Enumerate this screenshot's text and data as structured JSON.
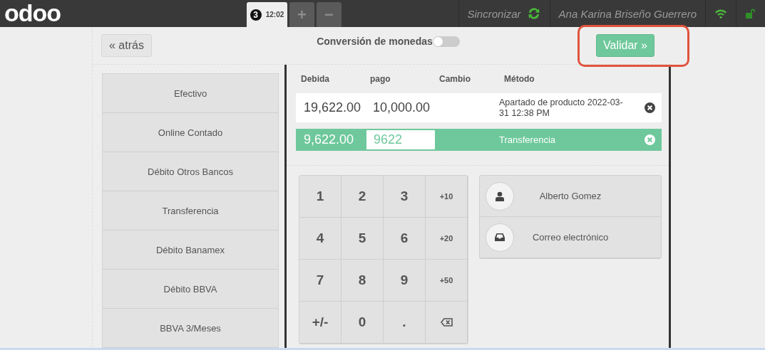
{
  "header": {
    "logo": "odoo",
    "orders": [
      {
        "number": "3",
        "time": "12:02",
        "selected": true
      }
    ],
    "add_order": "+",
    "remove_order": "−",
    "sync": "Sincronizar",
    "user": "Ana Karina Briseño Guerrero"
  },
  "toolbar": {
    "back": "« atrás",
    "title": "Conversión de monedas",
    "currency_conversion_on": false,
    "validate": "Validar »"
  },
  "payment_methods": [
    "Efectivo",
    "Online Contado",
    "Débito Otros Bancos",
    "Transferencia",
    "Débito Banamex",
    "Débito BBVA",
    "BBVA 3/Meses"
  ],
  "columns": [
    "Debida",
    "pago",
    "Cambio",
    "Método"
  ],
  "lines": [
    {
      "due": "19,622.00",
      "paid": "10,000.00",
      "method": "Apartado de producto 2022-03-31 12:38 PM",
      "selected": false
    },
    {
      "due": "9,622.00",
      "paid": "9622",
      "method": "Transferencia",
      "selected": true
    }
  ],
  "keypad": [
    {
      "kind": "digit",
      "label": "1"
    },
    {
      "kind": "digit",
      "label": "2"
    },
    {
      "kind": "digit",
      "label": "3"
    },
    {
      "kind": "add",
      "label": "+10"
    },
    {
      "kind": "digit",
      "label": "4"
    },
    {
      "kind": "digit",
      "label": "5"
    },
    {
      "kind": "digit",
      "label": "6"
    },
    {
      "kind": "add",
      "label": "+20"
    },
    {
      "kind": "digit",
      "label": "7"
    },
    {
      "kind": "digit",
      "label": "8"
    },
    {
      "kind": "digit",
      "label": "9"
    },
    {
      "kind": "add",
      "label": "+50"
    },
    {
      "kind": "digit",
      "label": "+/-"
    },
    {
      "kind": "digit",
      "label": "0"
    },
    {
      "kind": "digit",
      "label": "."
    },
    {
      "kind": "backspace"
    }
  ],
  "actions": [
    {
      "kind": "customer",
      "label": "Alberto Gomez"
    },
    {
      "kind": "email",
      "label": "Correo electrónico"
    }
  ]
}
